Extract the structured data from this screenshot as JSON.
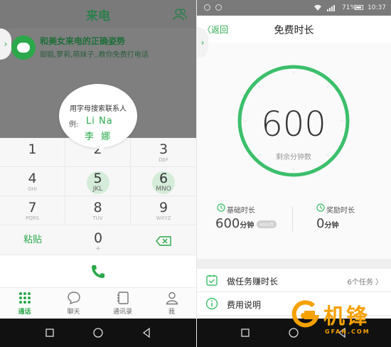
{
  "left": {
    "header": {
      "title": "来电"
    },
    "promo": {
      "title": "和美女来电的正确姿势",
      "subtitle": "御姐,萝莉,萌妹子..教你免费打电话"
    },
    "tooltip": {
      "title": "用字母搜索联系人",
      "example_label": "例:",
      "example_latin": "Li Na",
      "example_han": "李 娜"
    },
    "keypad": [
      {
        "num": "1",
        "letters": ""
      },
      {
        "num": "2",
        "letters": ""
      },
      {
        "num": "3",
        "letters": "DEF"
      },
      {
        "num": "4",
        "letters": "GHI"
      },
      {
        "num": "5",
        "letters": "JKL"
      },
      {
        "num": "6",
        "letters": "MNO"
      },
      {
        "num": "7",
        "letters": "PQRS"
      },
      {
        "num": "8",
        "letters": "TUV"
      },
      {
        "num": "9",
        "letters": "WXYZ"
      }
    ],
    "paste_label": "粘贴",
    "zero": {
      "num": "0",
      "letters": "+"
    },
    "tabs": [
      {
        "label": "通话"
      },
      {
        "label": "聊天"
      },
      {
        "label": "通讯录"
      },
      {
        "label": "我"
      }
    ]
  },
  "right": {
    "status": {
      "battery": "71%",
      "time": "10:37"
    },
    "header": {
      "back": "返回",
      "title": "免费时长"
    },
    "ring": {
      "value": "600",
      "caption": "剩余分钟数"
    },
    "stats": [
      {
        "label": "基础时长",
        "value": "600",
        "unit": "分钟",
        "badge": "600/月"
      },
      {
        "label": "奖励时长",
        "value": "0",
        "unit": "分钟"
      }
    ],
    "rows": [
      {
        "label": "做任务赚时长",
        "right": "6个任务 〉"
      },
      {
        "label": "费用说明",
        "right": ""
      }
    ]
  },
  "watermark": {
    "brand": "机锋",
    "domain": "GFAN.COM"
  },
  "colors": {
    "accent": "#2aa84a",
    "watermark": "#f5a100"
  }
}
